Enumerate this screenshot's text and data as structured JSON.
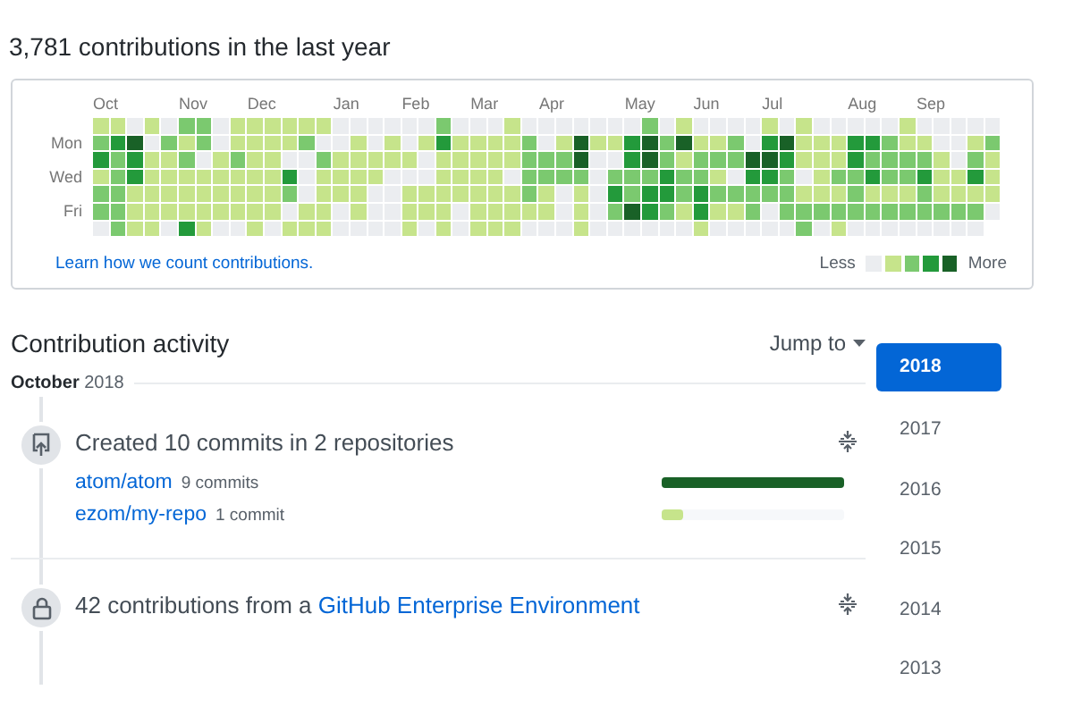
{
  "heading": "3,781 contributions in the last year",
  "calendar": {
    "day_labels": [
      "Mon",
      "Wed",
      "Fri"
    ],
    "weeks": [
      {
        "month": "Oct",
        "days": [
          {
            "color": "#c6e48b"
          },
          {
            "color": "#7bc96f"
          },
          {
            "color": "#239a3b"
          },
          {
            "color": "#c6e48b"
          },
          {
            "color": "#7bc96f"
          },
          {
            "color": "#7bc96f"
          },
          {
            "color": "#ebedf0"
          }
        ]
      },
      {
        "days": [
          {
            "color": "#c6e48b"
          },
          {
            "color": "#239a3b"
          },
          {
            "color": "#7bc96f"
          },
          {
            "color": "#7bc96f"
          },
          {
            "color": "#7bc96f"
          },
          {
            "color": "#7bc96f"
          },
          {
            "color": "#7bc96f"
          }
        ]
      },
      {
        "days": [
          {
            "color": "#ebedf0"
          },
          {
            "color": "#196127"
          },
          {
            "color": "#239a3b"
          },
          {
            "color": "#239a3b"
          },
          {
            "color": "#c6e48b"
          },
          {
            "color": "#c6e48b"
          },
          {
            "color": "#c6e48b"
          }
        ]
      },
      {
        "days": [
          {
            "color": "#c6e48b"
          },
          {
            "color": "#ebedf0"
          },
          {
            "color": "#c6e48b"
          },
          {
            "color": "#c6e48b"
          },
          {
            "color": "#c6e48b"
          },
          {
            "color": "#c6e48b"
          },
          {
            "color": "#c6e48b"
          }
        ]
      },
      {
        "days": [
          {
            "color": "#ebedf0"
          },
          {
            "color": "#7bc96f"
          },
          {
            "color": "#c6e48b"
          },
          {
            "color": "#c6e48b"
          },
          {
            "color": "#c6e48b"
          },
          {
            "color": "#c6e48b"
          },
          {
            "color": "#ebedf0"
          }
        ]
      },
      {
        "month": "Nov",
        "days": [
          {
            "color": "#7bc96f"
          },
          {
            "color": "#c6e48b"
          },
          {
            "color": "#7bc96f"
          },
          {
            "color": "#c6e48b"
          },
          {
            "color": "#c6e48b"
          },
          {
            "color": "#c6e48b"
          },
          {
            "color": "#239a3b"
          }
        ]
      },
      {
        "days": [
          {
            "color": "#7bc96f"
          },
          {
            "color": "#7bc96f"
          },
          {
            "color": "#ebedf0"
          },
          {
            "color": "#c6e48b"
          },
          {
            "color": "#c6e48b"
          },
          {
            "color": "#c6e48b"
          },
          {
            "color": "#c6e48b"
          }
        ]
      },
      {
        "days": [
          {
            "color": "#ebedf0"
          },
          {
            "color": "#ebedf0"
          },
          {
            "color": "#c6e48b"
          },
          {
            "color": "#c6e48b"
          },
          {
            "color": "#c6e48b"
          },
          {
            "color": "#c6e48b"
          },
          {
            "color": "#ebedf0"
          }
        ]
      },
      {
        "days": [
          {
            "color": "#c6e48b"
          },
          {
            "color": "#c6e48b"
          },
          {
            "color": "#7bc96f"
          },
          {
            "color": "#c6e48b"
          },
          {
            "color": "#c6e48b"
          },
          {
            "color": "#c6e48b"
          },
          {
            "color": "#ebedf0"
          }
        ]
      },
      {
        "month": "Dec",
        "days": [
          {
            "color": "#c6e48b"
          },
          {
            "color": "#c6e48b"
          },
          {
            "color": "#c6e48b"
          },
          {
            "color": "#c6e48b"
          },
          {
            "color": "#c6e48b"
          },
          {
            "color": "#c6e48b"
          },
          {
            "color": "#c6e48b"
          }
        ]
      },
      {
        "days": [
          {
            "color": "#c6e48b"
          },
          {
            "color": "#c6e48b"
          },
          {
            "color": "#c6e48b"
          },
          {
            "color": "#c6e48b"
          },
          {
            "color": "#c6e48b"
          },
          {
            "color": "#c6e48b"
          },
          {
            "color": "#ebedf0"
          }
        ]
      },
      {
        "days": [
          {
            "color": "#c6e48b"
          },
          {
            "color": "#c6e48b"
          },
          {
            "color": "#ebedf0"
          },
          {
            "color": "#239a3b"
          },
          {
            "color": "#7bc96f"
          },
          {
            "color": "#ebedf0"
          },
          {
            "color": "#c6e48b"
          }
        ]
      },
      {
        "days": [
          {
            "color": "#c6e48b"
          },
          {
            "color": "#7bc96f"
          },
          {
            "color": "#ebedf0"
          },
          {
            "color": "#ebedf0"
          },
          {
            "color": "#ebedf0"
          },
          {
            "color": "#c6e48b"
          },
          {
            "color": "#c6e48b"
          }
        ]
      },
      {
        "days": [
          {
            "color": "#c6e48b"
          },
          {
            "color": "#ebedf0"
          },
          {
            "color": "#7bc96f"
          },
          {
            "color": "#c6e48b"
          },
          {
            "color": "#c6e48b"
          },
          {
            "color": "#c6e48b"
          },
          {
            "color": "#c6e48b"
          }
        ]
      },
      {
        "month": "Jan",
        "days": [
          {
            "color": "#ebedf0"
          },
          {
            "color": "#ebedf0"
          },
          {
            "color": "#c6e48b"
          },
          {
            "color": "#c6e48b"
          },
          {
            "color": "#c6e48b"
          },
          {
            "color": "#ebedf0"
          },
          {
            "color": "#ebedf0"
          }
        ]
      },
      {
        "days": [
          {
            "color": "#ebedf0"
          },
          {
            "color": "#c6e48b"
          },
          {
            "color": "#c6e48b"
          },
          {
            "color": "#c6e48b"
          },
          {
            "color": "#c6e48b"
          },
          {
            "color": "#c6e48b"
          },
          {
            "color": "#ebedf0"
          }
        ]
      },
      {
        "days": [
          {
            "color": "#ebedf0"
          },
          {
            "color": "#ebedf0"
          },
          {
            "color": "#c6e48b"
          },
          {
            "color": "#c6e48b"
          },
          {
            "color": "#ebedf0"
          },
          {
            "color": "#ebedf0"
          },
          {
            "color": "#ebedf0"
          }
        ]
      },
      {
        "days": [
          {
            "color": "#ebedf0"
          },
          {
            "color": "#c6e48b"
          },
          {
            "color": "#c6e48b"
          },
          {
            "color": "#ebedf0"
          },
          {
            "color": "#ebedf0"
          },
          {
            "color": "#ebedf0"
          },
          {
            "color": "#ebedf0"
          }
        ]
      },
      {
        "month": "Feb",
        "days": [
          {
            "color": "#ebedf0"
          },
          {
            "color": "#ebedf0"
          },
          {
            "color": "#c6e48b"
          },
          {
            "color": "#ebedf0"
          },
          {
            "color": "#c6e48b"
          },
          {
            "color": "#c6e48b"
          },
          {
            "color": "#c6e48b"
          }
        ]
      },
      {
        "days": [
          {
            "color": "#ebedf0"
          },
          {
            "color": "#c6e48b"
          },
          {
            "color": "#ebedf0"
          },
          {
            "color": "#ebedf0"
          },
          {
            "color": "#c6e48b"
          },
          {
            "color": "#c6e48b"
          },
          {
            "color": "#ebedf0"
          }
        ]
      },
      {
        "days": [
          {
            "color": "#7bc96f"
          },
          {
            "color": "#239a3b"
          },
          {
            "color": "#c6e48b"
          },
          {
            "color": "#c6e48b"
          },
          {
            "color": "#c6e48b"
          },
          {
            "color": "#c6e48b"
          },
          {
            "color": "#c6e48b"
          }
        ]
      },
      {
        "days": [
          {
            "color": "#ebedf0"
          },
          {
            "color": "#c6e48b"
          },
          {
            "color": "#c6e48b"
          },
          {
            "color": "#c6e48b"
          },
          {
            "color": "#c6e48b"
          },
          {
            "color": "#ebedf0"
          },
          {
            "color": "#ebedf0"
          }
        ]
      },
      {
        "month": "Mar",
        "days": [
          {
            "color": "#ebedf0"
          },
          {
            "color": "#c6e48b"
          },
          {
            "color": "#c6e48b"
          },
          {
            "color": "#c6e48b"
          },
          {
            "color": "#c6e48b"
          },
          {
            "color": "#c6e48b"
          },
          {
            "color": "#c6e48b"
          }
        ]
      },
      {
        "days": [
          {
            "color": "#ebedf0"
          },
          {
            "color": "#c6e48b"
          },
          {
            "color": "#c6e48b"
          },
          {
            "color": "#c6e48b"
          },
          {
            "color": "#c6e48b"
          },
          {
            "color": "#c6e48b"
          },
          {
            "color": "#c6e48b"
          }
        ]
      },
      {
        "days": [
          {
            "color": "#c6e48b"
          },
          {
            "color": "#c6e48b"
          },
          {
            "color": "#c6e48b"
          },
          {
            "color": "#ebedf0"
          },
          {
            "color": "#c6e48b"
          },
          {
            "color": "#c6e48b"
          },
          {
            "color": "#c6e48b"
          }
        ]
      },
      {
        "days": [
          {
            "color": "#ebedf0"
          },
          {
            "color": "#7bc96f"
          },
          {
            "color": "#7bc96f"
          },
          {
            "color": "#7bc96f"
          },
          {
            "color": "#7bc96f"
          },
          {
            "color": "#c6e48b"
          },
          {
            "color": "#ebedf0"
          }
        ]
      },
      {
        "month": "Apr",
        "days": [
          {
            "color": "#ebedf0"
          },
          {
            "color": "#ebedf0"
          },
          {
            "color": "#7bc96f"
          },
          {
            "color": "#7bc96f"
          },
          {
            "color": "#c6e48b"
          },
          {
            "color": "#c6e48b"
          },
          {
            "color": "#ebedf0"
          }
        ]
      },
      {
        "days": [
          {
            "color": "#ebedf0"
          },
          {
            "color": "#c6e48b"
          },
          {
            "color": "#7bc96f"
          },
          {
            "color": "#7bc96f"
          },
          {
            "color": "#ebedf0"
          },
          {
            "color": "#ebedf0"
          },
          {
            "color": "#ebedf0"
          }
        ]
      },
      {
        "days": [
          {
            "color": "#ebedf0"
          },
          {
            "color": "#196127"
          },
          {
            "color": "#196127"
          },
          {
            "color": "#7bc96f"
          },
          {
            "color": "#c6e48b"
          },
          {
            "color": "#c6e48b"
          },
          {
            "color": "#c6e48b"
          }
        ]
      },
      {
        "days": [
          {
            "color": "#ebedf0"
          },
          {
            "color": "#c6e48b"
          },
          {
            "color": "#ebedf0"
          },
          {
            "color": "#ebedf0"
          },
          {
            "color": "#ebedf0"
          },
          {
            "color": "#ebedf0"
          },
          {
            "color": "#ebedf0"
          }
        ]
      },
      {
        "days": [
          {
            "color": "#ebedf0"
          },
          {
            "color": "#c6e48b"
          },
          {
            "color": "#ebedf0"
          },
          {
            "color": "#7bc96f"
          },
          {
            "color": "#239a3b"
          },
          {
            "color": "#7bc96f"
          },
          {
            "color": "#ebedf0"
          }
        ]
      },
      {
        "month": "May",
        "days": [
          {
            "color": "#ebedf0"
          },
          {
            "color": "#239a3b"
          },
          {
            "color": "#239a3b"
          },
          {
            "color": "#7bc96f"
          },
          {
            "color": "#7bc96f"
          },
          {
            "color": "#196127"
          },
          {
            "color": "#ebedf0"
          }
        ]
      },
      {
        "days": [
          {
            "color": "#7bc96f"
          },
          {
            "color": "#196127"
          },
          {
            "color": "#196127"
          },
          {
            "color": "#7bc96f"
          },
          {
            "color": "#239a3b"
          },
          {
            "color": "#239a3b"
          },
          {
            "color": "#ebedf0"
          }
        ]
      },
      {
        "days": [
          {
            "color": "#ebedf0"
          },
          {
            "color": "#7bc96f"
          },
          {
            "color": "#7bc96f"
          },
          {
            "color": "#239a3b"
          },
          {
            "color": "#239a3b"
          },
          {
            "color": "#7bc96f"
          },
          {
            "color": "#ebedf0"
          }
        ]
      },
      {
        "days": [
          {
            "color": "#c6e48b"
          },
          {
            "color": "#196127"
          },
          {
            "color": "#c6e48b"
          },
          {
            "color": "#7bc96f"
          },
          {
            "color": "#7bc96f"
          },
          {
            "color": "#c6e48b"
          },
          {
            "color": "#ebedf0"
          }
        ]
      },
      {
        "month": "Jun",
        "days": [
          {
            "color": "#ebedf0"
          },
          {
            "color": "#c6e48b"
          },
          {
            "color": "#7bc96f"
          },
          {
            "color": "#7bc96f"
          },
          {
            "color": "#239a3b"
          },
          {
            "color": "#239a3b"
          },
          {
            "color": "#c6e48b"
          }
        ]
      },
      {
        "days": [
          {
            "color": "#ebedf0"
          },
          {
            "color": "#c6e48b"
          },
          {
            "color": "#7bc96f"
          },
          {
            "color": "#c6e48b"
          },
          {
            "color": "#7bc96f"
          },
          {
            "color": "#c6e48b"
          },
          {
            "color": "#ebedf0"
          }
        ]
      },
      {
        "days": [
          {
            "color": "#ebedf0"
          },
          {
            "color": "#7bc96f"
          },
          {
            "color": "#7bc96f"
          },
          {
            "color": "#ebedf0"
          },
          {
            "color": "#7bc96f"
          },
          {
            "color": "#c6e48b"
          },
          {
            "color": "#ebedf0"
          }
        ]
      },
      {
        "days": [
          {
            "color": "#ebedf0"
          },
          {
            "color": "#ebedf0"
          },
          {
            "color": "#196127"
          },
          {
            "color": "#239a3b"
          },
          {
            "color": "#7bc96f"
          },
          {
            "color": "#7bc96f"
          },
          {
            "color": "#ebedf0"
          }
        ]
      },
      {
        "month": "Jul",
        "days": [
          {
            "color": "#c6e48b"
          },
          {
            "color": "#239a3b"
          },
          {
            "color": "#196127"
          },
          {
            "color": "#239a3b"
          },
          {
            "color": "#7bc96f"
          },
          {
            "color": "#ebedf0"
          },
          {
            "color": "#ebedf0"
          }
        ]
      },
      {
        "days": [
          {
            "color": "#ebedf0"
          },
          {
            "color": "#196127"
          },
          {
            "color": "#239a3b"
          },
          {
            "color": "#7bc96f"
          },
          {
            "color": "#7bc96f"
          },
          {
            "color": "#7bc96f"
          },
          {
            "color": "#ebedf0"
          }
        ]
      },
      {
        "days": [
          {
            "color": "#c6e48b"
          },
          {
            "color": "#c6e48b"
          },
          {
            "color": "#c6e48b"
          },
          {
            "color": "#ebedf0"
          },
          {
            "color": "#c6e48b"
          },
          {
            "color": "#7bc96f"
          },
          {
            "color": "#7bc96f"
          }
        ]
      },
      {
        "days": [
          {
            "color": "#ebedf0"
          },
          {
            "color": "#c6e48b"
          },
          {
            "color": "#c6e48b"
          },
          {
            "color": "#c6e48b"
          },
          {
            "color": "#c6e48b"
          },
          {
            "color": "#7bc96f"
          },
          {
            "color": "#ebedf0"
          }
        ]
      },
      {
        "days": [
          {
            "color": "#ebedf0"
          },
          {
            "color": "#c6e48b"
          },
          {
            "color": "#c6e48b"
          },
          {
            "color": "#7bc96f"
          },
          {
            "color": "#c6e48b"
          },
          {
            "color": "#7bc96f"
          },
          {
            "color": "#c6e48b"
          }
        ]
      },
      {
        "month": "Aug",
        "days": [
          {
            "color": "#ebedf0"
          },
          {
            "color": "#239a3b"
          },
          {
            "color": "#239a3b"
          },
          {
            "color": "#7bc96f"
          },
          {
            "color": "#7bc96f"
          },
          {
            "color": "#7bc96f"
          },
          {
            "color": "#ebedf0"
          }
        ]
      },
      {
        "days": [
          {
            "color": "#ebedf0"
          },
          {
            "color": "#239a3b"
          },
          {
            "color": "#7bc96f"
          },
          {
            "color": "#239a3b"
          },
          {
            "color": "#c6e48b"
          },
          {
            "color": "#7bc96f"
          },
          {
            "color": "#ebedf0"
          }
        ]
      },
      {
        "days": [
          {
            "color": "#ebedf0"
          },
          {
            "color": "#7bc96f"
          },
          {
            "color": "#7bc96f"
          },
          {
            "color": "#7bc96f"
          },
          {
            "color": "#c6e48b"
          },
          {
            "color": "#7bc96f"
          },
          {
            "color": "#ebedf0"
          }
        ]
      },
      {
        "days": [
          {
            "color": "#c6e48b"
          },
          {
            "color": "#c6e48b"
          },
          {
            "color": "#7bc96f"
          },
          {
            "color": "#7bc96f"
          },
          {
            "color": "#c6e48b"
          },
          {
            "color": "#7bc96f"
          },
          {
            "color": "#ebedf0"
          }
        ]
      },
      {
        "month": "Sep",
        "days": [
          {
            "color": "#ebedf0"
          },
          {
            "color": "#c6e48b"
          },
          {
            "color": "#7bc96f"
          },
          {
            "color": "#239a3b"
          },
          {
            "color": "#7bc96f"
          },
          {
            "color": "#7bc96f"
          },
          {
            "color": "#ebedf0"
          }
        ]
      },
      {
        "days": [
          {
            "color": "#ebedf0"
          },
          {
            "color": "#ebedf0"
          },
          {
            "color": "#c6e48b"
          },
          {
            "color": "#c6e48b"
          },
          {
            "color": "#c6e48b"
          },
          {
            "color": "#7bc96f"
          },
          {
            "color": "#ebedf0"
          }
        ]
      },
      {
        "days": [
          {
            "color": "#ebedf0"
          },
          {
            "color": "#ebedf0"
          },
          {
            "color": "#ebedf0"
          },
          {
            "color": "#c6e48b"
          },
          {
            "color": "#c6e48b"
          },
          {
            "color": "#7bc96f"
          },
          {
            "color": "#ebedf0"
          }
        ]
      },
      {
        "days": [
          {
            "color": "#ebedf0"
          },
          {
            "color": "#c6e48b"
          },
          {
            "color": "#7bc96f"
          },
          {
            "color": "#239a3b"
          },
          {
            "color": "#c6e48b"
          },
          {
            "color": "#7bc96f"
          },
          {
            "color": "#ebedf0"
          }
        ]
      },
      {
        "days": [
          {
            "color": "#ebedf0"
          },
          {
            "color": "#7bc96f"
          },
          {
            "color": "#c6e48b"
          },
          {
            "color": "#c6e48b"
          },
          {
            "color": "#c6e48b"
          },
          {
            "color": "#ebedf0"
          }
        ]
      }
    ],
    "learn_link": "Learn how we count contributions.",
    "legend": {
      "less": "Less",
      "more": "More",
      "swatches": [
        {
          "color": "#ebedf0"
        },
        {
          "color": "#c6e48b"
        },
        {
          "color": "#7bc96f"
        },
        {
          "color": "#239a3b"
        },
        {
          "color": "#196127"
        }
      ]
    }
  },
  "activity": {
    "title": "Contribution activity",
    "jump_to": "Jump to",
    "month_heading": "**October** 2018",
    "items": [
      {
        "kind": "commits",
        "title": "Created 10 commits in 2 repositories",
        "repos": [
          {
            "name": "atom/atom",
            "count": "9 commits",
            "level": 1
          },
          {
            "name": "ezom/my-repo",
            "count": "1 commit",
            "level": 0.12
          }
        ]
      },
      {
        "kind": "enterprise",
        "title": "42 contributions from a ",
        "link": "GitHub Enterprise Environment"
      }
    ]
  },
  "years": [
    {
      "label": "2018",
      "selected": true
    },
    {
      "label": "2017",
      "selected": false
    },
    {
      "label": "2016",
      "selected": false
    },
    {
      "label": "2015",
      "selected": false
    },
    {
      "label": "2014",
      "selected": false
    },
    {
      "label": "2013",
      "selected": false
    }
  ]
}
